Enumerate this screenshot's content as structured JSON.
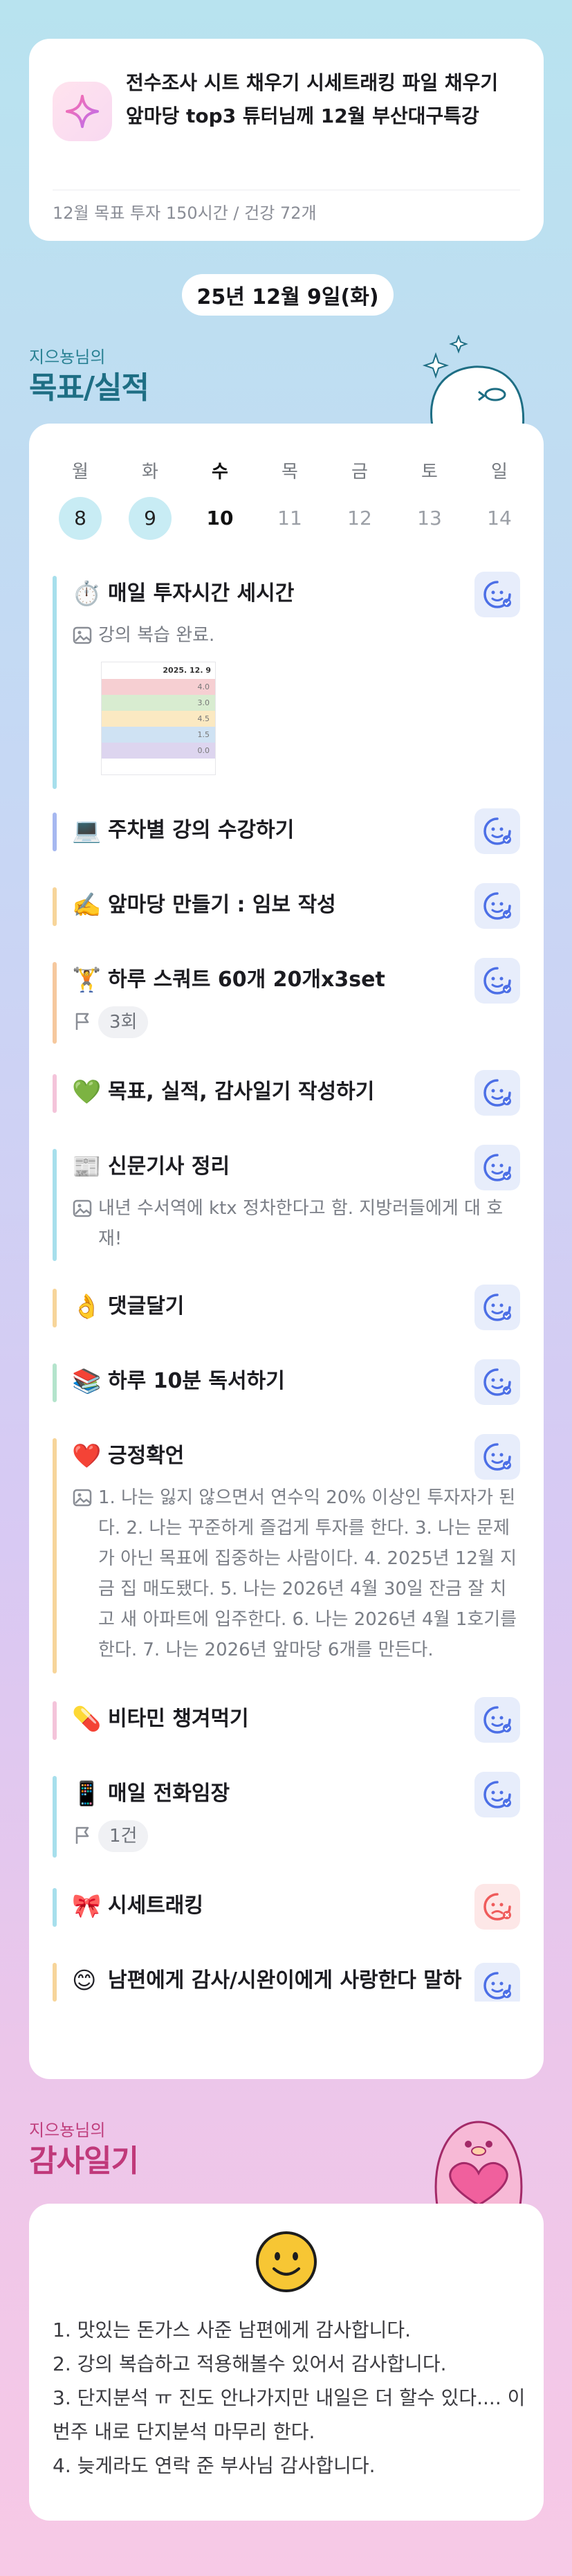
{
  "goal_card": {
    "title": "전수조사 시트 채우기 시세트래킹 파일 채우기 앞마당 top3 튜터님께 12월 부산대구특강",
    "subtitle": "12월 목표  투자 150시간 / 건강 72개",
    "icon": "sparkle-icon"
  },
  "date": "25년 12월 9일(화)",
  "goals_section": {
    "owner": "지으뇽님의",
    "title": "목표/실적"
  },
  "week": [
    {
      "name": "월",
      "date": "8",
      "state": "done"
    },
    {
      "name": "화",
      "date": "9",
      "state": "done"
    },
    {
      "name": "수",
      "date": "10",
      "state": "today"
    },
    {
      "name": "목",
      "date": "11",
      "state": "future"
    },
    {
      "name": "금",
      "date": "12",
      "state": "future"
    },
    {
      "name": "토",
      "date": "13",
      "state": "future"
    },
    {
      "name": "일",
      "date": "14",
      "state": "future"
    }
  ],
  "tasks": [
    {
      "emoji": "⏱️",
      "name": "매일 투자시간 세시간",
      "bar_color": "#a7dfec",
      "status": "checked",
      "note": "강의 복습 완료."
    },
    {
      "emoji": "💻",
      "name": "주차별 강의 수강하기",
      "bar_color": "#a6b8f0",
      "status": "checked"
    },
    {
      "emoji": "✍️",
      "name": "앞마당 만들기 : 임보 작성",
      "bar_color": "#f7d59a",
      "status": "checked"
    },
    {
      "emoji": "🏋️",
      "name": "하루 스쿼트 60개 20개x3set",
      "bar_color": "#f6c89e",
      "status": "checked",
      "count": "3회"
    },
    {
      "emoji": "💚",
      "name": "목표, 실적, 감사일기 작성하기",
      "bar_color": "#f4c4da",
      "status": "checked"
    },
    {
      "emoji": "📰",
      "name": "신문기사 정리",
      "bar_color": "#a7dfec",
      "status": "checked",
      "note": "내년 수서역에 ktx 정차한다고 함. 지방러들에게 대 호재!"
    },
    {
      "emoji": "👌",
      "name": "댓글달기",
      "bar_color": "#f7d59a",
      "status": "checked"
    },
    {
      "emoji": "📚",
      "name": "하루 10분 독서하기",
      "bar_color": "#b4e4cc",
      "status": "checked"
    },
    {
      "emoji": "❤️",
      "name": "긍정확언",
      "bar_color": "#f7d59a",
      "status": "checked",
      "note": "1. 나는 잃지 않으면서 연수익 20% 이상인 투자자가 된다. 2. 나는 꾸준하게 즐겁게 투자를 한다. 3. 나는 문제가 아닌 목표에 집중하는 사람이다. 4. 2025년 12월 지금 집 매도됐다. 5. 나는 2026년 4월 30일 잔금 잘 치고 새 아파트에 입주한다. 6. 나는 2026년 4월 1호기를 한다. 7. 나는 2026년 앞마당 6개를 만든다."
    },
    {
      "emoji": "💊",
      "name": "비타민 챙겨먹기",
      "bar_color": "#f4c4da",
      "status": "checked"
    },
    {
      "emoji": "📱",
      "name": "매일 전화임장",
      "bar_color": "#a7dfec",
      "status": "checked",
      "count": "1건"
    },
    {
      "emoji": "🎀",
      "name": "시세트래킹",
      "bar_color": "#a7dfec",
      "status": "failed"
    },
    {
      "emoji": "😊",
      "name": "남편에게 감사/시완이에게 사랑한다 말하",
      "bar_color": "#f7d59a",
      "status": "checked"
    }
  ],
  "thumbnail": {
    "header": "2025. 12. 9",
    "rows": [
      {
        "value": "4.0",
        "color": "#f6cfd2"
      },
      {
        "value": "3.0",
        "color": "#d8ecd0"
      },
      {
        "value": "4.5",
        "color": "#fbe9c2"
      },
      {
        "value": "1.5",
        "color": "#cfe2f3"
      },
      {
        "value": "0.0",
        "color": "#ddd5ef"
      }
    ]
  },
  "thanks_section": {
    "owner": "지으뇽님의",
    "title": "감사일기"
  },
  "thanks_text": "1. 맛있는 돈가스 사준 남편에게 감사합니다.\n2. 강의 복습하고 적용해볼수 있어서 감사합니다.\n3. 단지분석 ㅠ 진도 안나가지만 내일은 더 할수 있다.... 이번주 내로 단지분석 마무리 한다.\n4. 늦게라도 연락 준 부사님 감사합니다.",
  "colors": {
    "accent_teal": "#1e6e84",
    "accent_pink": "#c0397a",
    "done_day": "#c8ecf4",
    "check_bg": "#e7edfb",
    "fail_bg": "#fde7e7"
  }
}
